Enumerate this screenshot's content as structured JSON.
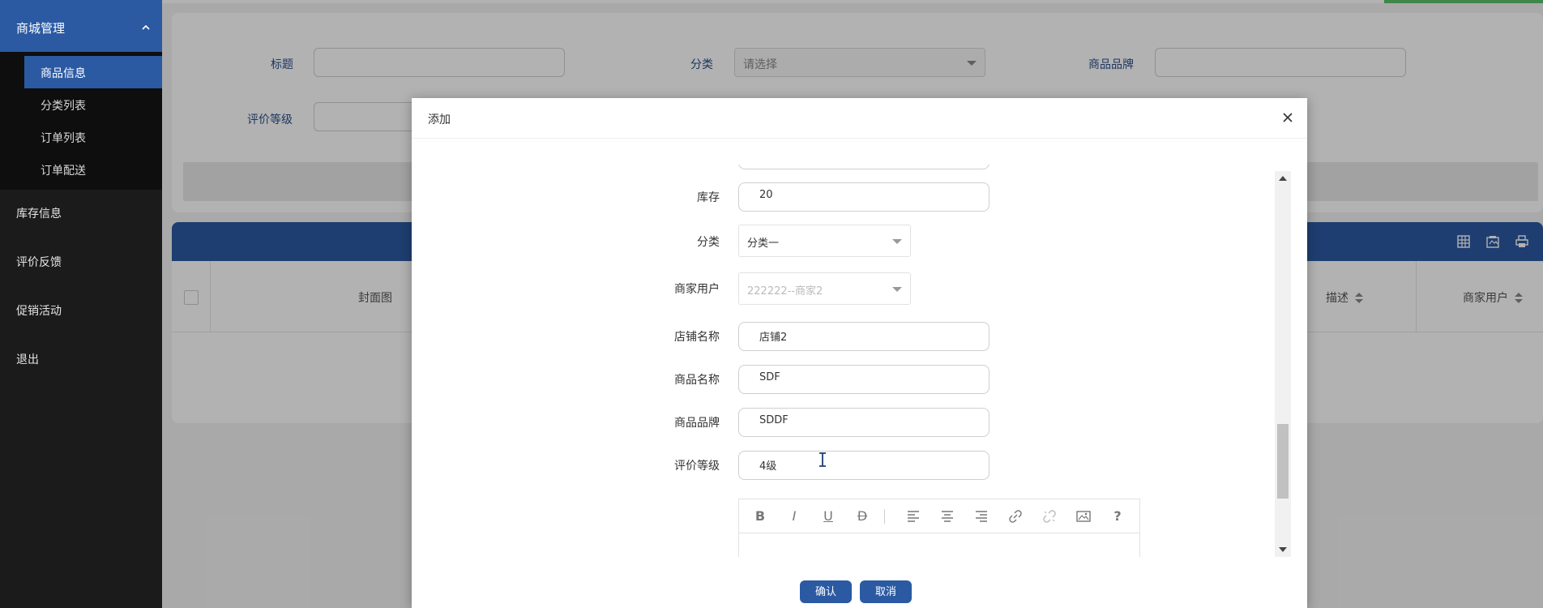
{
  "sidebar": {
    "header": "商城管理",
    "submenu": [
      "商品信息",
      "分类列表",
      "订单列表",
      "订单配送"
    ],
    "items": [
      "库存信息",
      "评价反馈",
      "促销活动",
      "退出"
    ]
  },
  "filter": {
    "title_label": "标题",
    "category_label": "分类",
    "category_placeholder": "请选择",
    "brand_label": "商品品牌",
    "rating_label": "评价等级"
  },
  "table": {
    "headers": {
      "cover": "封面图",
      "desc": "描述",
      "merchant": "商家用户"
    }
  },
  "modal": {
    "title": "添加",
    "fields": {
      "stock_label": "库存",
      "stock_value": "20",
      "category_label": "分类",
      "category_value": "分类一",
      "merchant_label": "商家用户",
      "merchant_value": "222222--商家2",
      "shop_label": "店铺名称",
      "shop_value": "店铺2",
      "product_label": "商品名称",
      "product_value": "SDF",
      "brand_label": "商品品牌",
      "brand_value": "SDDF",
      "rating_label": "评价等级",
      "rating_value": "4级"
    },
    "editor_tools": [
      "B",
      "I",
      "U",
      "D",
      "?"
    ],
    "confirm": "确认",
    "cancel": "取消"
  },
  "colors": {
    "primary": "#2b5aa3",
    "sidebar_bg": "#1b1b1b",
    "accent_green": "#5cc26a"
  },
  "icons": [
    "chevron-up-icon",
    "close-icon",
    "table-icon",
    "export-icon",
    "print-icon",
    "sort-icon",
    "bold-icon",
    "italic-icon",
    "underline-icon",
    "strikethrough-icon",
    "align-left-icon",
    "align-center-icon",
    "align-right-icon",
    "link-icon",
    "unlink-icon",
    "image-icon",
    "help-icon"
  ]
}
